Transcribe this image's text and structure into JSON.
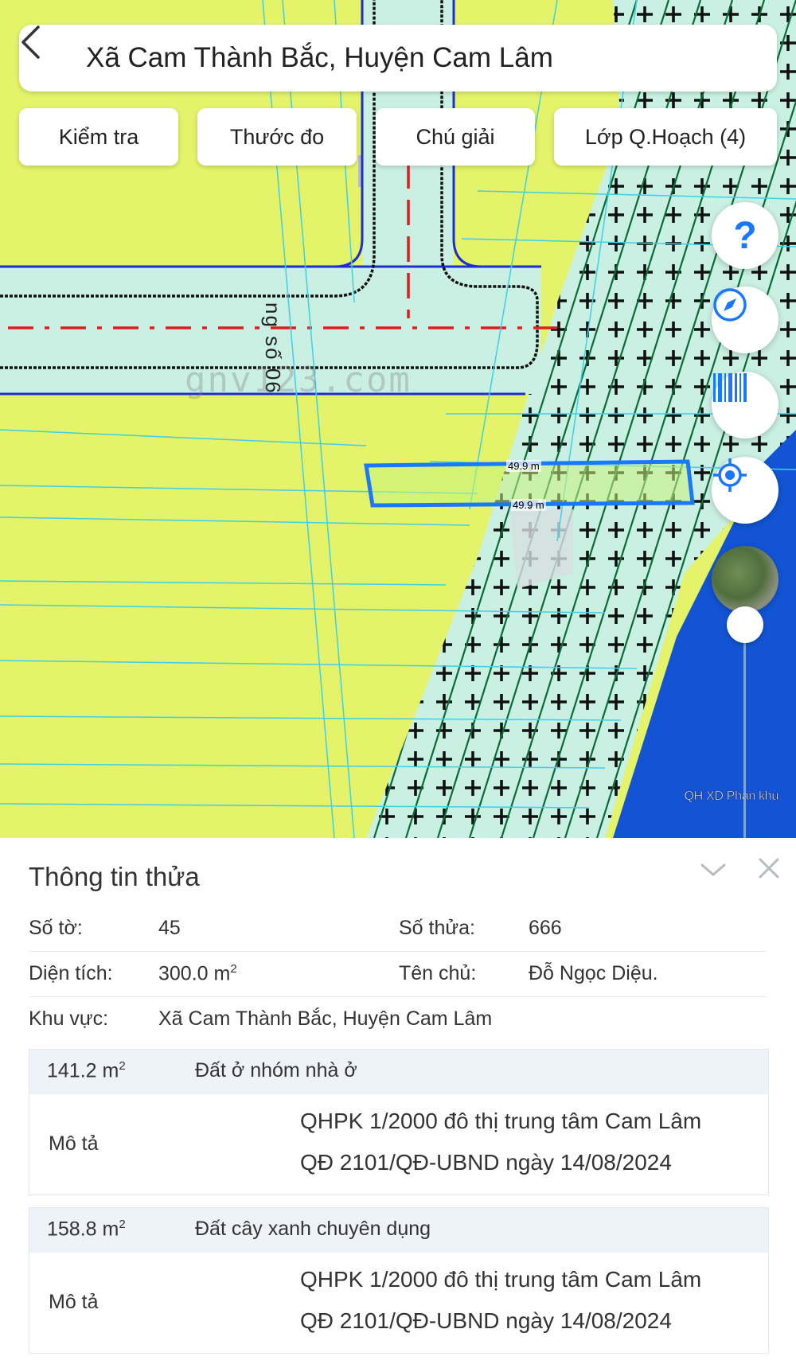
{
  "header": {
    "title": "Xã Cam Thành Bắc, Huyện Cam Lâm"
  },
  "toolbar": {
    "check_label": "Kiểm tra",
    "measure_label": "Thước đo",
    "legend_label": "Chú giải",
    "layers_label": "Lớp Q.Hoạch (4)"
  },
  "map": {
    "road_name": "ng số 06",
    "watermark": "gnv123.com",
    "edge_top_label": "49.9 m",
    "edge_bottom_label": "49.9 m",
    "layer_label": "QH XD Phân khu",
    "help_glyph": "?",
    "colors": {
      "residential": "#e4f36a",
      "green_space": "#c9f0e2",
      "water": "#1254d4",
      "road": "#c9f0e2",
      "parcel_outline": "#1a78ff",
      "centerline": "#e01e1e"
    },
    "icons": [
      "back-icon",
      "help-icon",
      "compass-icon",
      "barcode-icon",
      "locate-icon",
      "satellite-icon"
    ]
  },
  "parcel": {
    "title": "Thông tin thửa",
    "sheet_label": "Số tờ:",
    "sheet_value": "45",
    "plot_label": "Số thửa:",
    "plot_value": "666",
    "area_label": "Diện tích:",
    "area_value": "300.0 m",
    "area_unit_sup": "2",
    "owner_label": "Tên chủ:",
    "owner_value": "Đỗ Ngọc Diệu.",
    "region_label": "Khu vực:",
    "region_value": "Xã Cam Thành Bắc, Huyện Cam Lâm",
    "zones": [
      {
        "area": "141.2 m",
        "area_sup": "2",
        "type": "Đất ở nhóm nhà ở",
        "desc_label": "Mô tả",
        "desc_line1": "QHPK 1/2000 đô thị trung tâm Cam Lâm",
        "desc_line2": "QĐ 2101/QĐ-UBND ngày 14/08/2024"
      },
      {
        "area": "158.8 m",
        "area_sup": "2",
        "type": "Đất cây xanh chuyên dụng",
        "desc_label": "Mô tả",
        "desc_line1": "QHPK 1/2000 đô thị trung tâm Cam Lâm",
        "desc_line2": "QĐ 2101/QĐ-UBND ngày 14/08/2024"
      }
    ]
  }
}
